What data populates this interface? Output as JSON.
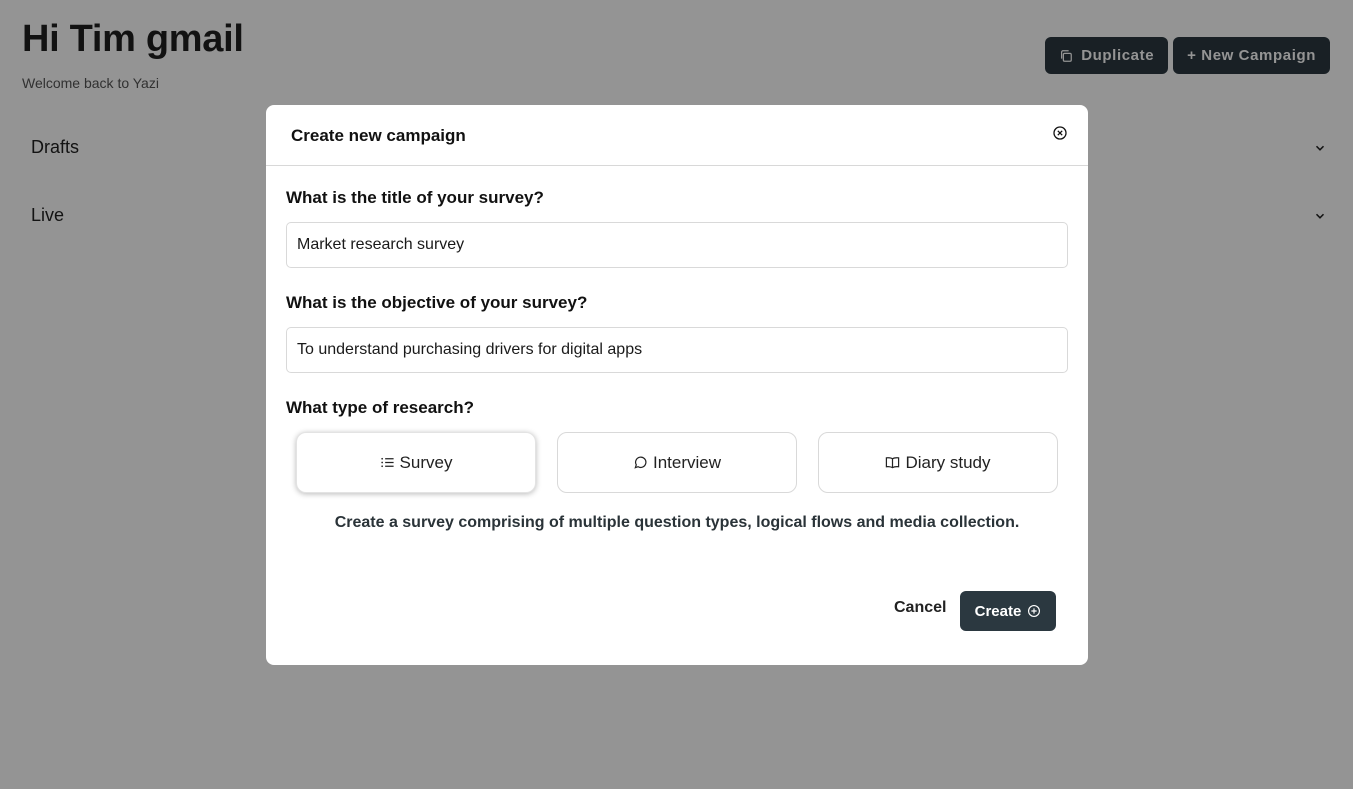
{
  "header": {
    "greeting": "Hi Tim gmail",
    "welcome": "Welcome back to Yazi",
    "duplicate_label": "Duplicate",
    "new_campaign_label": "+ New Campaign",
    "duplicate_icon": "copy-icon"
  },
  "sections": {
    "drafts": {
      "label": "Drafts",
      "icon": "chevron-down-icon"
    },
    "live": {
      "label": "Live",
      "icon": "chevron-down-icon"
    }
  },
  "modal": {
    "title": "Create new campaign",
    "close_icon": "close-circle-icon",
    "title_question": "What is the title of your survey?",
    "title_value": "Market research survey",
    "objective_question": "What is the objective of your survey?",
    "objective_value": "To understand purchasing drivers for digital apps",
    "type_question": "What type of research?",
    "types": [
      {
        "label": "Survey",
        "icon": "list-icon",
        "selected": true
      },
      {
        "label": "Interview",
        "icon": "chat-bubble-icon",
        "selected": false
      },
      {
        "label": "Diary study",
        "icon": "open-book-icon",
        "selected": false
      }
    ],
    "type_description": "Create a survey comprising of multiple question types, logical flows and media collection.",
    "cancel_label": "Cancel",
    "create_label": "Create",
    "create_icon": "plus-circle-icon"
  },
  "colors": {
    "overlay": "#000000",
    "primary_button": "#2b3840"
  }
}
